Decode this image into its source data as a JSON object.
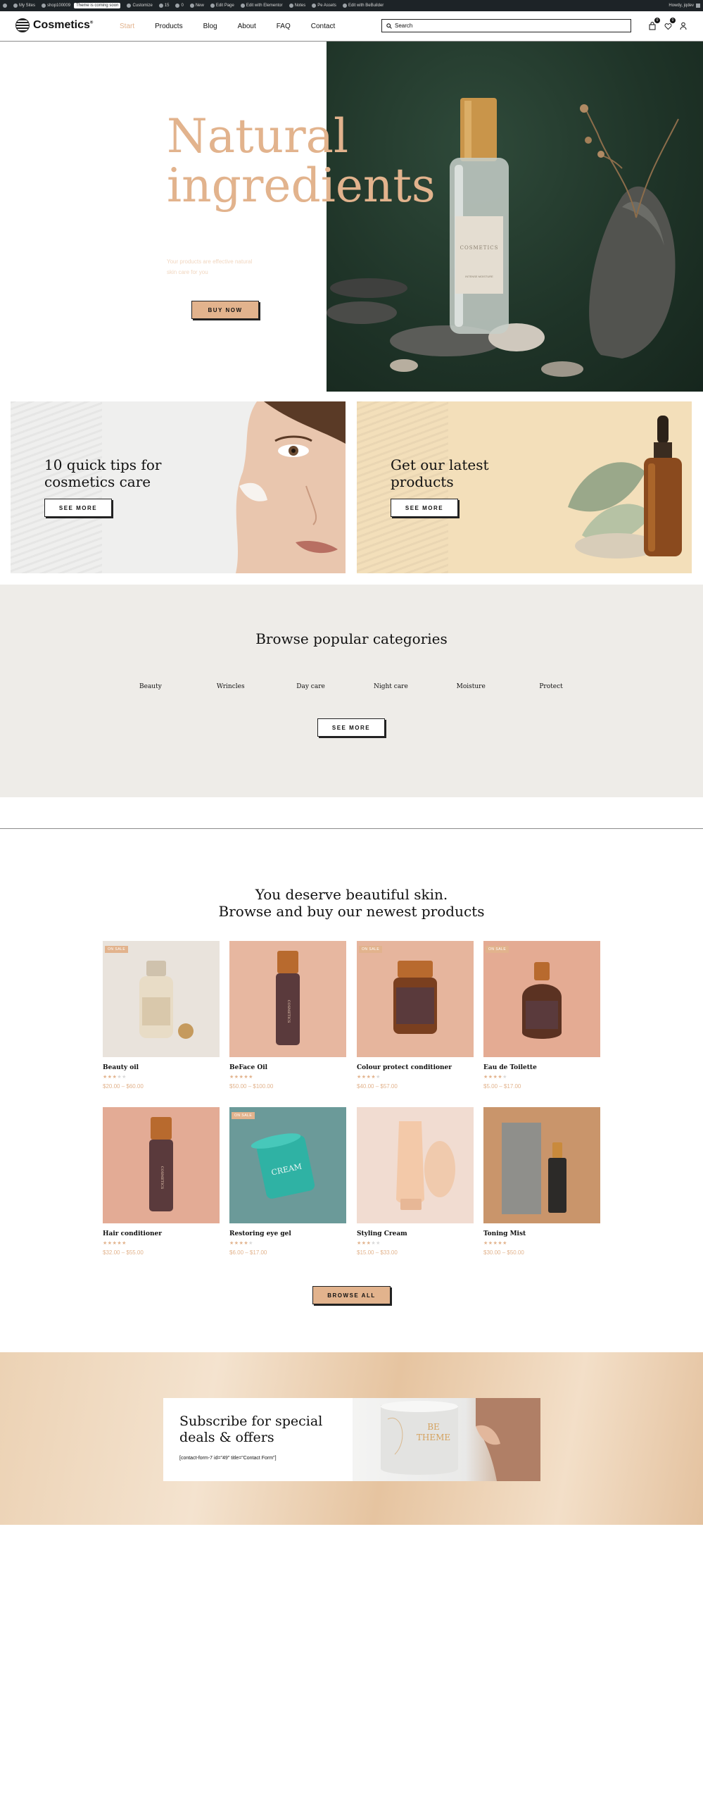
{
  "admin_bar": {
    "items": [
      "My Sites",
      "shop100009",
      "Customize",
      "15",
      "0",
      "New",
      "Edit Page",
      "Edit with Elementor",
      "Notes",
      "Pe Assets",
      "Edit with BeBuilder"
    ],
    "badge": "Theme is coming soon",
    "howdy": "Howdy, jqdev"
  },
  "header": {
    "logo_text": "Cosmetics",
    "logo_mark": "®",
    "nav": [
      "Start",
      "Products",
      "Blog",
      "About",
      "FAQ",
      "Contact"
    ],
    "active_nav": "Start",
    "search_placeholder": "Search",
    "cart_count": "0",
    "wishlist_count": "0"
  },
  "hero": {
    "title_line1": "Natural",
    "title_line2": "ingredients",
    "subtitle": "Your products                    are effective natural skin care for you",
    "button": "BUY NOW",
    "bottle_label": "COSMETICS",
    "bottle_sub": "INTENSE MOISTURE"
  },
  "promos": [
    {
      "title_line1": "10 quick tips for",
      "title_line2": "cosmetics care",
      "button": "SEE MORE"
    },
    {
      "title_line1": "Get our latest",
      "title_line2": "products",
      "button": "SEE MORE"
    }
  ],
  "categories": {
    "title": "Browse popular categories",
    "items": [
      "Beauty",
      "Wrincles",
      "Day care",
      "Night care",
      "Moisture",
      "Protect"
    ],
    "button": "SEE MORE"
  },
  "products": {
    "title_line1": "You deserve beautiful skin.",
    "title_line2": "Browse and buy our newest products",
    "items": [
      {
        "name": "Beauty oil",
        "price": "$20.00 – $60.00",
        "rating": 3,
        "sale": "ON SALE",
        "bg": "#e9e3dc"
      },
      {
        "name": "BeFace Oil",
        "price": "$50.00 – $100.00",
        "rating": 5,
        "sale": "",
        "bg": "#e7b7a0"
      },
      {
        "name": "Colour protect conditioner",
        "price": "$40.00 – $57.00",
        "rating": 4,
        "sale": "ON SALE",
        "bg": "#e6b59d"
      },
      {
        "name": "Eau de Toilette",
        "price": "$5.00 – $17.00",
        "rating": 4,
        "sale": "ON SALE",
        "bg": "#e4ab93"
      },
      {
        "name": "Hair conditioner",
        "price": "$32.00 – $55.00",
        "rating": 5,
        "sale": "",
        "bg": "#e3ab95"
      },
      {
        "name": "Restoring eye gel",
        "price": "$6.00 – $17.00",
        "rating": 4,
        "sale": "ON SALE",
        "bg": "#6b9a99"
      },
      {
        "name": "Styling Cream",
        "price": "$15.00 – $33.00",
        "rating": 3,
        "sale": "",
        "bg": "#f1dcd1"
      },
      {
        "name": "Toning Mist",
        "price": "$30.00 – $50.00",
        "rating": 5,
        "sale": "",
        "bg": "#c9956b"
      }
    ],
    "bottle_text": "COSMETICS",
    "jar_text": "CREAM",
    "button": "BROWSE ALL"
  },
  "subscribe": {
    "title_line1": "Subscribe for special",
    "title_line2": "deals & offers",
    "form_shortcode": "[contact-form-7 id=\"49\" title=\"Contact Form\"]",
    "jar_text_line1": "BE",
    "jar_text_line2": "THEME"
  },
  "colors": {
    "accent": "#e2b38d",
    "dark_green": "#1f3428",
    "beige": "#eeece8"
  }
}
